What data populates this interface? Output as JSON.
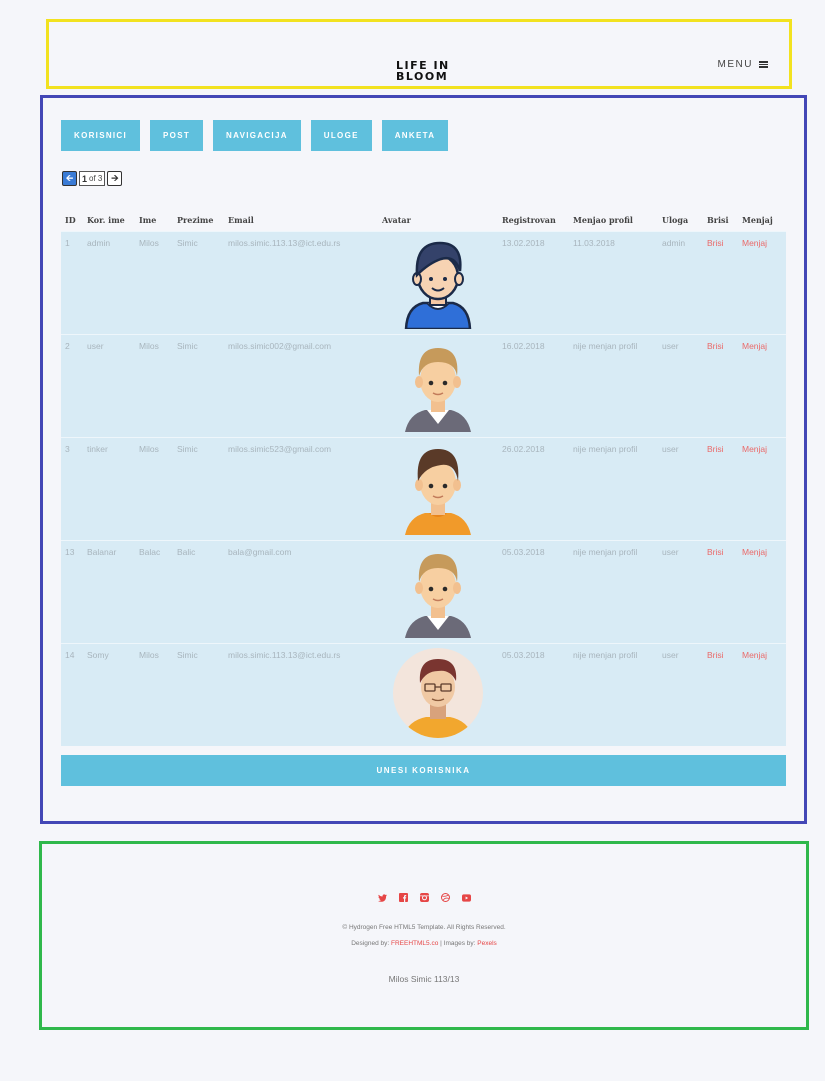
{
  "header": {
    "brand_line1": "LIFE IN",
    "brand_line2": "BLOOM",
    "menu_label": "MENU"
  },
  "nav_buttons": [
    "KORISNICI",
    "POST",
    "NAVIGACIJA",
    "ULOGE",
    "ANKETA"
  ],
  "pager": {
    "prev_icon": "arrow-left-icon",
    "current": "1",
    "of_label": "of 3",
    "next_icon": "arrow-right-icon"
  },
  "table": {
    "columns": [
      "ID",
      "Kor. ime",
      "Ime",
      "Prezime",
      "Email",
      "Avatar",
      "Registrovan",
      "Menjao profil",
      "Uloga",
      "Brisi",
      "Menjaj"
    ],
    "rows": [
      {
        "id": "1",
        "username": "admin",
        "first": "Milos",
        "last": "Simic",
        "email": "milos.simic.113.13@ict.edu.rs",
        "avatar": "avatar-dark-hair-blue-shirt",
        "registered": "13.02.2018",
        "modified": "11.03.2018",
        "role": "admin",
        "delete": "Brisi",
        "edit": "Menjaj"
      },
      {
        "id": "2",
        "username": "user",
        "first": "Milos",
        "last": "Simic",
        "email": "milos.simic002@gmail.com",
        "avatar": "avatar-blond-grey-shirt",
        "registered": "16.02.2018",
        "modified": "nije menjan profil",
        "role": "user",
        "delete": "Brisi",
        "edit": "Menjaj"
      },
      {
        "id": "3",
        "username": "tinker",
        "first": "Milos",
        "last": "Simic",
        "email": "milos.simic523@gmail.com",
        "avatar": "avatar-brown-hair-orange-shirt",
        "registered": "26.02.2018",
        "modified": "nije menjan profil",
        "role": "user",
        "delete": "Brisi",
        "edit": "Menjaj"
      },
      {
        "id": "13",
        "username": "Balanar",
        "first": "Balac",
        "last": "Balic",
        "email": "bala@gmail.com",
        "avatar": "avatar-blond-grey-shirt",
        "registered": "05.03.2018",
        "modified": "nije menjan profil",
        "role": "user",
        "delete": "Brisi",
        "edit": "Menjaj"
      },
      {
        "id": "14",
        "username": "Somy",
        "first": "Milos",
        "last": "Simic",
        "email": "milos.simic.113.13@ict.edu.rs",
        "avatar": "avatar-circle-glasses",
        "registered": "05.03.2018",
        "modified": "nije menjan profil",
        "role": "user",
        "delete": "Brisi",
        "edit": "Menjaj"
      }
    ]
  },
  "add_button": "UNESI KORISNIKA",
  "footer": {
    "social_icons": [
      "twitter-icon",
      "facebook-icon",
      "instagram-icon",
      "dribbble-icon",
      "youtube-icon"
    ],
    "copyright": "© Hydrogen Free HTML5 Template. All Rights Reserved.",
    "designed_prefix": "Designed by:",
    "designed_link": "FREEHTML5.co",
    "images_prefix": "| Images by:",
    "images_link": "Pexels",
    "author": "Milos Simic 113/13"
  },
  "colors": {
    "accent": "#5fc0dd",
    "row_bg": "#d8ebf5",
    "link_red": "#ea6a6a",
    "header_border": "#f2e21f",
    "main_border": "#4347b6",
    "footer_border": "#2fb84b"
  }
}
